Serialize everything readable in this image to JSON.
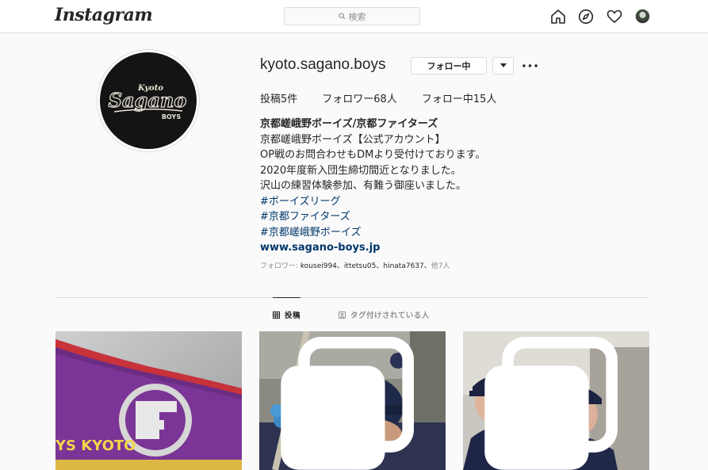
{
  "nav": {
    "logo": "Instagram",
    "search_placeholder": "検索"
  },
  "profile": {
    "username": "kyoto.sagano.boys",
    "follow_button": "フォロー中",
    "avatar_logo_top": "Kyoto",
    "avatar_logo_main": "Sagano",
    "avatar_logo_sub": "BOYS",
    "stats": {
      "posts": "投稿5件",
      "followers": "フォロワー68人",
      "following": "フォロー中15人"
    },
    "bio": {
      "name": "京都嵯峨野ボーイズ/京都ファイターズ",
      "line1": "京都嵯峨野ボーイズ【公式アカウント】",
      "line2": "OP戦のお問合わせもDMより受付けております。",
      "line3": "2020年度新入団生締切間近となりました。",
      "line4": "沢山の練習体験参加、有難う御座いました。",
      "tag1": "#ボーイズリーグ",
      "tag2": "#京都ファイターズ",
      "tag3": "#京都嵯峨野ボーイズ",
      "website": "www.sagano-boys.jp"
    },
    "followed_by_prefix": "フォロワー: ",
    "followed_by_users": "kousei994、ittetsu05、hinata7637、",
    "followed_by_suffix": "他7人"
  },
  "tabs": {
    "posts": "投稿",
    "tagged": "タグ付けされている人"
  },
  "posts": [
    {
      "banner_text": "YS KYOTO"
    },
    {
      "multi": true
    },
    {
      "multi": true
    }
  ],
  "colors": {
    "link": "#00376b",
    "muted": "#8e8e8e",
    "border": "#dbdbdb"
  }
}
